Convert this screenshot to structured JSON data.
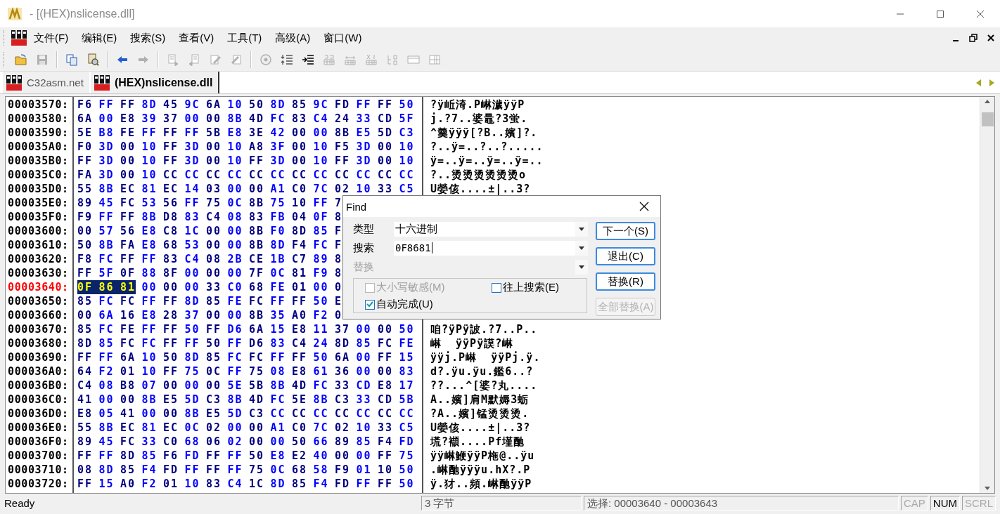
{
  "window": {
    "title": "- [(HEX)nslicense.dll]"
  },
  "menu": [
    "文件(F)",
    "编辑(E)",
    "搜索(S)",
    "查看(V)",
    "工具(T)",
    "高级(A)",
    "窗口(W)"
  ],
  "toolbar": [
    [
      {
        "disabled": false
      },
      {
        "disabled": true
      }
    ],
    [
      {
        "disabled": false
      },
      {
        "disabled": false
      }
    ],
    [
      {
        "disabled": false
      },
      {
        "disabled": true
      }
    ],
    [
      {
        "disabled": true
      },
      {
        "disabled": true
      },
      {
        "disabled": true
      },
      {
        "disabled": true
      }
    ],
    [
      {
        "disabled": true
      },
      {
        "disabled": false
      },
      {
        "disabled": false
      },
      {
        "disabled": true
      },
      {
        "disabled": true
      },
      {
        "disabled": true
      },
      {
        "disabled": true
      },
      {
        "disabled": true
      },
      {
        "disabled": true
      }
    ]
  ],
  "tabs": [
    {
      "label": "C32asm.net",
      "selected": false
    },
    {
      "label": "(HEX)nslicense.dll",
      "selected": true
    }
  ],
  "hex_view": {
    "rows": [
      {
        "address": "00003570:",
        "selected": false,
        "bytes": "F6 FF FF 8D 45 9C 6A 10 50 8D 85 9C FD FF FF 50",
        "text": "?ÿ岴渏.P崊濊ÿÿP"
      },
      {
        "address": "00003580:",
        "selected": false,
        "bytes": "6A 00 E8 39 37 00 00 8B 4D FC 83 C4 24 33 CD 5F",
        "text": "j.?7..婆鼂?3蛍."
      },
      {
        "address": "00003590:",
        "selected": false,
        "bytes": "5E B8 FE FF FF FF 5B E8 3E 42 00 00 8B E5 5D C3",
        "text": "^羹ÿÿÿ[?B..嬪]?."
      },
      {
        "address": "000035A0:",
        "selected": false,
        "bytes": "F0 3D 00 10 FF 3D 00 10 A8 3F 00 10 F5 3D 00 10",
        "text": "?..ÿ=..?..?....."
      },
      {
        "address": "000035B0:",
        "selected": false,
        "bytes": "FF 3D 00 10 FF 3D 00 10 FF 3D 00 10 FF 3D 00 10",
        "text": "ÿ=..ÿ=..ÿ=..ÿ=.."
      },
      {
        "address": "000035C0:",
        "selected": false,
        "bytes": "FA 3D 00 10 CC CC CC CC CC CC CC CC CC CC CC CC",
        "text": "?..烫烫烫烫烫烫o"
      },
      {
        "address": "000035D0:",
        "selected": false,
        "bytes": "55 8B EC 81 EC 14 03 00 00 A1 C0 7C 02 10 33 C5",
        "text": "U嫈侅....±|..3?"
      },
      {
        "address": "000035E0:",
        "selected": false,
        "bytes": "89 45 FC 53 56 FF 75 0C 8B 75 10 FF 7"
      },
      {
        "address": "000035F0:",
        "selected": false,
        "bytes": "F9 FF FF 8B D8 83 C4 08 83 FB 04 0F 8"
      },
      {
        "address": "00003600:",
        "selected": false,
        "bytes": "00 57 56 E8 C8 1C 00 00 8B F0 8D 85 F"
      },
      {
        "address": "00003610:",
        "selected": false,
        "bytes": "50 8B FA E8 68 53 00 00 8B 8D F4 FC F"
      },
      {
        "address": "00003620:",
        "selected": false,
        "bytes": "F8 FC FF FF 83 C4 08 2B CE 1B C7 89 8"
      },
      {
        "address": "00003630:",
        "selected": false,
        "bytes": "FF 5F 0F 88 8F 00 00 00 7F 0C 81 F9 8"
      },
      {
        "address": "00003640:",
        "selected": true,
        "highlight": "0F 86 81",
        "bytes": "00 00 00 33 C0 68 FE 01 00 0"
      },
      {
        "address": "00003650:",
        "selected": false,
        "bytes": "85 FC FC FF FF 8D 85 FE FC FF FF 50 E"
      },
      {
        "address": "00003660:",
        "selected": false,
        "bytes": "00 6A 16 E8 28 37 00 00 8B 35 A0 F2 0"
      },
      {
        "address": "00003670:",
        "selected": false,
        "bytes": "85 FC FE FF FF 50 FF D6 6A 15 E8 11 37 00 00 50",
        "text": "咱?ÿPÿ詖.?7..P.."
      },
      {
        "address": "00003680:",
        "selected": false,
        "bytes": "8D 85 FC FC FF FF 50 FF D6 83 C4 24 8D 85 FC FE",
        "text": "崊  ÿÿPÿ謨?崊"
      },
      {
        "address": "00003690:",
        "selected": false,
        "bytes": "FF FF 6A 10 50 8D 85 FC FC FF FF 50 6A 00 FF 15",
        "text": "ÿÿj.P崊  ÿÿPj.ÿ."
      },
      {
        "address": "000036A0:",
        "selected": false,
        "bytes": "64 F2 01 10 FF 75 0C FF 75 08 E8 61 36 00 00 83",
        "text": "d?.ÿu.ÿu.鑑6..?"
      },
      {
        "address": "000036B0:",
        "selected": false,
        "bytes": "C4 08 B8 07 00 00 00 5E 5B 8B 4D FC 33 CD E8 17",
        "text": "??...^[婆?丸...."
      },
      {
        "address": "000036C0:",
        "selected": false,
        "bytes": "41 00 00 8B E5 5D C3 8B 4D FC 5E 8B C3 33 CD 5B",
        "text": "A..嬪]肩M默媷3蛎"
      },
      {
        "address": "000036D0:",
        "selected": false,
        "bytes": "E8 05 41 00 00 8B E5 5D C3 CC CC CC CC CC CC CC",
        "text": "?A..嬪]锰烫烫烫."
      },
      {
        "address": "000036E0:",
        "selected": false,
        "bytes": "55 8B EC 81 EC 0C 02 00 00 A1 C0 7C 02 10 33 C5",
        "text": "U嫈侅....±|..3?"
      },
      {
        "address": "000036F0:",
        "selected": false,
        "bytes": "89 45 FC 33 C0 68 06 02 00 00 50 66 89 85 F4 FD",
        "text": "塃?襭....Pf墐酏"
      },
      {
        "address": "00003700:",
        "selected": false,
        "bytes": "FF FF 8D 85 F6 FD FF FF 50 E8 E2 40 00 00 FF 75",
        "text": "ÿÿ崊鯾ÿÿP柂@..ÿu"
      },
      {
        "address": "00003710:",
        "selected": false,
        "bytes": "08 8D 85 F4 FD FF FF FF 75 0C 68 58 F9 01 10 50",
        "text": ".崊酏ÿÿÿu.hX?.P"
      },
      {
        "address": "00003720:",
        "selected": false,
        "bytes": "FF 15 A0 F2 01 10 83 C4 1C 8D 85 F4 FD FF FF 50",
        "text": "ÿ.犲..頻.崊酏ÿÿP"
      }
    ]
  },
  "find_dialog": {
    "title": "Find",
    "fields": [
      {
        "label": "类型",
        "value": "十六进制",
        "disabled": false,
        "focused": false
      },
      {
        "label": "搜索",
        "value": "0F8681",
        "disabled": false,
        "focused": true
      },
      {
        "label": "替换",
        "disabled": true,
        "focused": false
      }
    ],
    "options": [
      {
        "label": "大小写敏感(M)",
        "checked": false,
        "disabled": true
      },
      {
        "label": "往上搜索(E)",
        "checked": false,
        "disabled": false
      },
      {
        "label": "自动完成(U)",
        "checked": true,
        "disabled": false
      }
    ],
    "buttons": [
      {
        "label": "下一个(S)",
        "disabled": false
      },
      {
        "label": "退出(C)",
        "disabled": false
      },
      {
        "label": "替换(R)",
        "disabled": false
      },
      {
        "label": "全部替换(A)",
        "disabled": true
      }
    ]
  },
  "status_bar": {
    "message": "Ready",
    "panels": [
      "3 字节",
      "选择: 00003640 - 00003643"
    ],
    "indicators": [
      {
        "label": "CAP",
        "on": false
      },
      {
        "label": "NUM",
        "on": true
      },
      {
        "label": "SCRL",
        "on": false
      }
    ]
  }
}
